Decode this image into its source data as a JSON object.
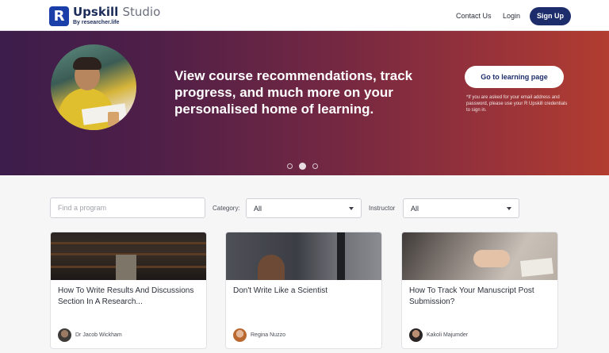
{
  "header": {
    "logo_mark": "R",
    "logo_name": "Upskill",
    "logo_studio": "Studio",
    "logo_sub": "By researcher.life",
    "contact_label": "Contact Us",
    "login_label": "Login",
    "signup_label": "Sign Up"
  },
  "banner": {
    "title": "View course recommendations, track progress, and much more on your personalised home of learning.",
    "cta_label": "Go to learning page",
    "note": "*If you are asked for your email address and password, please use your R Upskill credentials to sign in.",
    "carousel_active_index": 1,
    "carousel_count": 3
  },
  "filters": {
    "search_placeholder": "Find a program",
    "category_label": "Category:",
    "category_value": "All",
    "instructor_label": "Instructor",
    "instructor_value": "All"
  },
  "cards": [
    {
      "title": "How To Write Results And Discussions Section In A Research...",
      "author": "Dr Jacob Wickham"
    },
    {
      "title": "Don't Write Like a Scientist",
      "author": "Regina Nuzzo"
    },
    {
      "title": "How To Track Your Manuscript Post Submission?",
      "author": "Kakoli Majumder"
    }
  ],
  "colors": {
    "brand_navy": "#1d2d6b",
    "banner_start": "#3c1d4b",
    "banner_end": "#b23d30"
  }
}
